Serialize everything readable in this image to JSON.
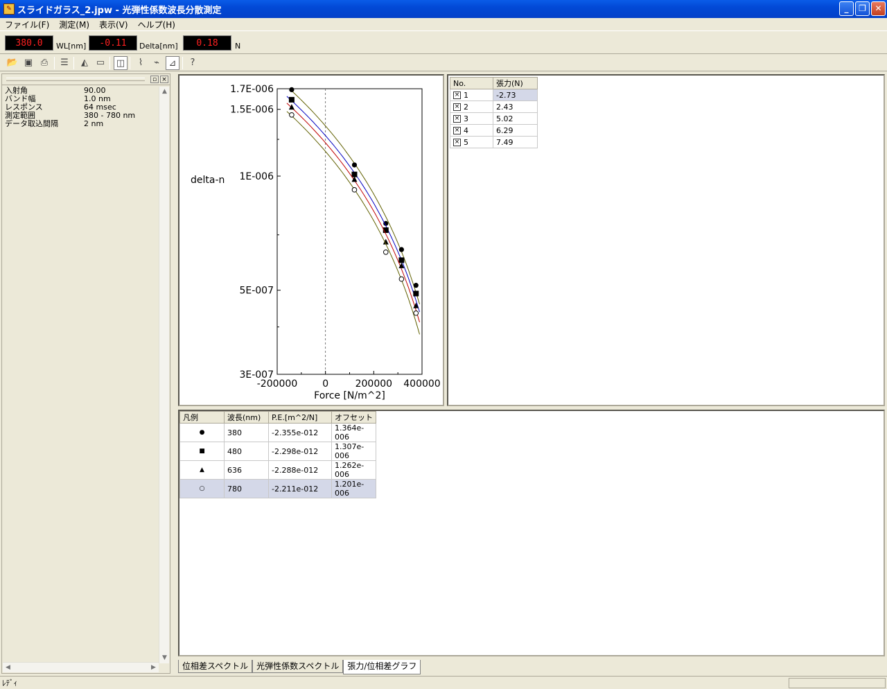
{
  "window": {
    "title": "スライドガラス_2.jpw - 光弾性係数波長分散測定",
    "min": "_",
    "max": "❐",
    "close": "✕"
  },
  "menu": [
    "ファイル(F)",
    "測定(M)",
    "表示(V)",
    "ヘルプ(H)"
  ],
  "readouts": {
    "wl_value": "380.0",
    "wl_unit": "WL[nm]",
    "delta_value": "-0.11",
    "delta_unit": "Delta[nm]",
    "force_value": "0.18",
    "force_unit": "N"
  },
  "toolbar_icons": [
    "open-folder-icon",
    "save-icon",
    "print-icon",
    "settings-icon",
    "measure-icon",
    "window-icon",
    "view-toggle-icon",
    "spectrum-icon",
    "pe-spectrum-icon",
    "tension-graph-icon",
    "help-icon"
  ],
  "properties": [
    {
      "key": "入射角",
      "value": "90.00"
    },
    {
      "key": "バンド幅",
      "value": "1.0 nm"
    },
    {
      "key": "レスポンス",
      "value": "64 msec"
    },
    {
      "key": "測定範囲",
      "value": "380 - 780 nm"
    },
    {
      "key": "データ取込間隔",
      "value": "2 nm"
    }
  ],
  "tension_table": {
    "headers": [
      "No.",
      "張力(N)"
    ],
    "rows": [
      {
        "no": "1",
        "tension": "-2.73"
      },
      {
        "no": "2",
        "tension": "2.43"
      },
      {
        "no": "3",
        "tension": "5.02"
      },
      {
        "no": "4",
        "tension": "6.29"
      },
      {
        "no": "5",
        "tension": "7.49"
      }
    ]
  },
  "legend_table": {
    "headers": [
      "凡例",
      "波長(nm)",
      "P.E.[m^2/N]",
      "オフセット"
    ],
    "rows": [
      {
        "symbol": "●",
        "wl": "380",
        "pe": "-2.355e-012",
        "offset": "1.364e-006"
      },
      {
        "symbol": "■",
        "wl": "480",
        "pe": "-2.298e-012",
        "offset": "1.307e-006"
      },
      {
        "symbol": "▲",
        "wl": "636",
        "pe": "-2.288e-012",
        "offset": "1.262e-006"
      },
      {
        "symbol": "○",
        "wl": "780",
        "pe": "-2.211e-012",
        "offset": "1.201e-006"
      }
    ]
  },
  "tabs": [
    "位相差スペクトル",
    "光弾性係数スペクトル",
    "張力/位相差グラフ"
  ],
  "status": "ﾚﾃﾞｨ",
  "chart_data": {
    "type": "scatter",
    "xlabel": "Force [N/m^2]",
    "ylabel": "delta-n",
    "xlim": [
      -200000,
      400000
    ],
    "ylim": [
      3e-07,
      1.7e-06
    ],
    "y_scale": "log",
    "xticks": [
      "-200000",
      "0",
      "200000",
      "400000"
    ],
    "yticks": [
      "1.7E-006",
      "1.5E-006",
      "1E-006",
      "5E-007",
      "3E-007"
    ],
    "x": [
      -140000,
      120000,
      250000,
      315000,
      375000
    ],
    "series": [
      {
        "symbol": "circle-filled",
        "values": [
          1.69e-06,
          1.07e-06,
          7.5e-07,
          6.4e-07,
          5.15e-07
        ],
        "line_color": "#606000"
      },
      {
        "symbol": "square-filled",
        "values": [
          1.59e-06,
          1.01e-06,
          7.2e-07,
          6e-07,
          4.9e-07
        ],
        "line_color": "#0000c0"
      },
      {
        "symbol": "triangle-filled",
        "values": [
          1.52e-06,
          9.8e-07,
          6.7e-07,
          5.8e-07,
          4.55e-07
        ],
        "line_color": "#c00000"
      },
      {
        "symbol": "circle-open",
        "values": [
          1.45e-06,
          9.2e-07,
          6.3e-07,
          5.35e-07,
          4.35e-07
        ],
        "line_color": "#606000"
      }
    ],
    "zero_line": "dashed"
  }
}
